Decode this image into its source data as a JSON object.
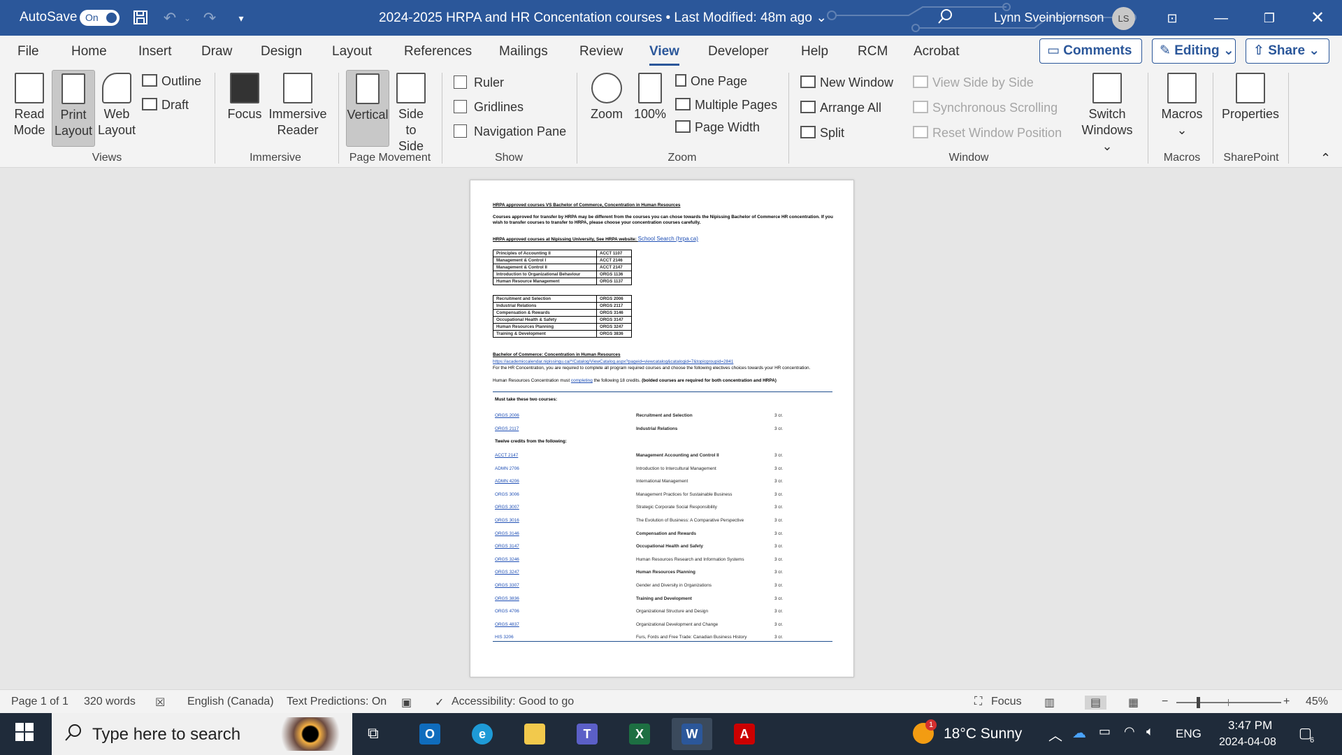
{
  "titlebar": {
    "autosave_label": "AutoSave",
    "autosave_state": "On",
    "doc_title": "2024-2025 HRPA and HR Concentation courses • Last Modified: 48m ago ⌄",
    "user_name": "Lynn Sveinbjornson",
    "user_initials": "LS"
  },
  "tabs": [
    "File",
    "Home",
    "Insert",
    "Draw",
    "Design",
    "Layout",
    "References",
    "Mailings",
    "Review",
    "View",
    "Developer",
    "Help",
    "RCM",
    "Acrobat"
  ],
  "top_buttons": {
    "comments": "Comments",
    "editing": "Editing ⌄",
    "share": "Share ⌄"
  },
  "ribbon": {
    "views": {
      "read_mode": [
        "Read",
        "Mode"
      ],
      "print_layout": [
        "Print",
        "Layout"
      ],
      "web_layout": [
        "Web",
        "Layout"
      ],
      "outline": "Outline",
      "draft": "Draft",
      "group": "Views"
    },
    "immersive": {
      "focus": "Focus",
      "reader": [
        "Immersive",
        "Reader"
      ],
      "group": "Immersive"
    },
    "page_movement": {
      "vertical": "Vertical",
      "side": [
        "Side",
        "to Side"
      ],
      "group": "Page Movement"
    },
    "show": {
      "ruler": "Ruler",
      "gridlines": "Gridlines",
      "nav_pane": "Navigation Pane",
      "group": "Show"
    },
    "zoom": {
      "zoom": "Zoom",
      "pct": "100%",
      "one_page": "One Page",
      "multiple_pages": "Multiple Pages",
      "page_width": "Page Width",
      "group": "Zoom"
    },
    "window": {
      "new_window": "New Window",
      "arrange_all": "Arrange All",
      "split": "Split",
      "view_side": "View Side by Side",
      "sync_scroll": "Synchronous Scrolling",
      "reset_pos": "Reset Window Position",
      "switch": [
        "Switch",
        "Windows ⌄"
      ],
      "group": "Window"
    },
    "macros": {
      "label": "Macros",
      "group": "Macros"
    },
    "sharepoint": {
      "label": "Properties",
      "group": "SharePoint"
    }
  },
  "document": {
    "heading1": "HRPA approved courses VS Bachelor of Commerce, Concentration in Human Resources",
    "intro": "Courses approved for transfer by HRPA may be different from the courses you can chose towards the Nipissing Bachelor of Commerce HR concentration. If you wish to transfer courses to transfer to HRPA, please choose your concentration courses carefully.",
    "website_label": "HRPA approved courses at Nipissing University, See HRPA website: ",
    "website_link": "School Search (hrpa.ca)",
    "hrpa_table_a": [
      [
        "Principles of Accounting II",
        "ACCT 1107"
      ],
      [
        "Management & Control I",
        "ACCT 2146"
      ],
      [
        "Management & Control II",
        "ACCT 2147"
      ],
      [
        "Introduction to Organizational Behaviour",
        "ORGS 1136"
      ],
      [
        "Human Resource Management",
        "ORGS 1137"
      ]
    ],
    "hrpa_table_b": [
      [
        "Recruitment and Selection",
        "ORGS 2006"
      ],
      [
        "Industrial Relations",
        "ORGS 2117"
      ],
      [
        "Compensation & Rewards",
        "ORGS 3146"
      ],
      [
        "Occupational Health & Safety",
        "ORGS 3147"
      ],
      [
        "Human Resources Planning",
        "ORGS 3247"
      ],
      [
        "Training & Development",
        "ORGS 3836"
      ]
    ],
    "heading2": "Bachelor of Commerce: Concentration in Human Resources",
    "catalog_url": "https://academiccalendar.nipissingu.ca/*/Catalog/ViewCatalog.aspx?pageid=viewcatalog&catalogid=7&topicgroupid=2841",
    "hr_note": "For the HR Concentration, you are required to complete all program required courses and choose the following electives choices towards your HR concentration.",
    "credit_note_a": "Human Resources Concentration must ",
    "credit_note_link": "completing",
    "credit_note_b": " the following 18 credits. ",
    "credit_note_bold": "(bolded courses are required for both concentration and HRPA)",
    "must_take": "Must take these two courses:",
    "required": [
      {
        "code": "ORGS 2006",
        "title": "Recruitment and Selection",
        "cr": "3 cr.",
        "bold": true,
        "link": true
      },
      {
        "code": "ORGS 2117",
        "title": "Industrial Relations",
        "cr": "3 cr.",
        "bold": true,
        "link": true
      }
    ],
    "twelve": "Twelve credits from the following:",
    "electives": [
      {
        "code": "ACCT 2147",
        "title": "Management Accounting and Control II",
        "cr": "3 cr.",
        "bold": true,
        "link": true
      },
      {
        "code": "ADMN 2706",
        "title": "Introduction to Intercultural Management",
        "cr": "3 cr.",
        "bold": false,
        "link": false
      },
      {
        "code": "ADMN 4206",
        "title": "International Management",
        "cr": "3 cr.",
        "bold": false,
        "link": true
      },
      {
        "code": "ORGS 3006",
        "title": "Management Practices for Sustainable Business",
        "cr": "3 cr.",
        "bold": false,
        "link": false
      },
      {
        "code": "ORGS 3007",
        "title": "Strategic Corporate Social Responsibility",
        "cr": "3 cr.",
        "bold": false,
        "link": true
      },
      {
        "code": "ORGS 3016",
        "title": "The Evolution of Business: A Comparative Perspective",
        "cr": "3 cr.",
        "bold": false,
        "link": true
      },
      {
        "code": "ORGS 3146",
        "title": "Compensation and Rewards",
        "cr": "3 cr.",
        "bold": true,
        "link": true
      },
      {
        "code": "ORGS 3147",
        "title": "Occupational Health and Safety",
        "cr": "3 cr.",
        "bold": true,
        "link": true
      },
      {
        "code": "ORGS 3246",
        "title": "Human Resources Research and Information Systems",
        "cr": "3 cr.",
        "bold": false,
        "link": true
      },
      {
        "code": "ORGS 3247",
        "title": "Human Resources Planning",
        "cr": "3 cr.",
        "bold": true,
        "link": true
      },
      {
        "code": "ORGS 3307",
        "title": "Gender and Diversity in Organizations",
        "cr": "3 cr.",
        "bold": false,
        "link": true
      },
      {
        "code": "ORGS 3836",
        "title": "Training and Development",
        "cr": "3 cr.",
        "bold": true,
        "link": true
      },
      {
        "code": "ORGS 4706",
        "title": "Organizational Structure and Design",
        "cr": "3 cr.",
        "bold": false,
        "link": false
      },
      {
        "code": "ORGS 4837",
        "title": "Organizational Development and Change",
        "cr": "3 cr.",
        "bold": false,
        "link": true
      },
      {
        "code": "HIS 3206",
        "title": "Furs, Fords and Free Trade: Canadian Business History",
        "cr": "3 cr.",
        "bold": false,
        "link": false
      }
    ]
  },
  "statusbar": {
    "page": "Page 1 of 1",
    "words": "320 words",
    "language": "English (Canada)",
    "predictions": "Text Predictions: On",
    "accessibility": "Accessibility: Good to go",
    "focus": "Focus",
    "zoom": "45%"
  },
  "taskbar": {
    "search_placeholder": "Type here to search",
    "weather": "18°C  Sunny",
    "weather_badge": "1",
    "lang": "ENG",
    "time": "3:47 PM",
    "date": "2024-04-08",
    "notif_count": "6"
  },
  "colors": {
    "word_blue": "#2b579a",
    "taskbar": "#1f2b3a",
    "link": "#1f4fb5"
  }
}
